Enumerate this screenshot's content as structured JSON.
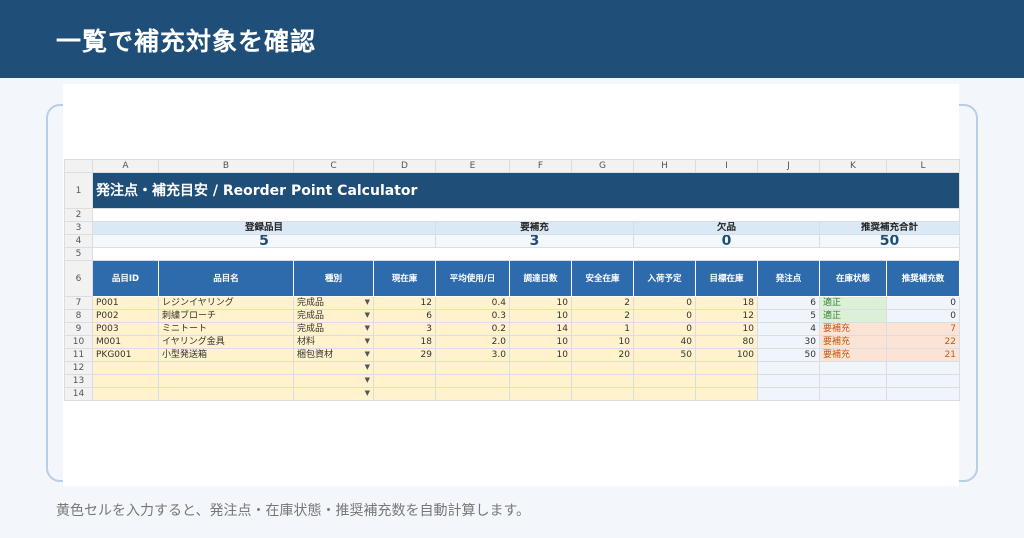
{
  "header": {
    "title": "一覧で補充対象を確認"
  },
  "footer": {
    "note": "黄色セルを入力すると、発注点・在庫状態・推奨補充数を自動計算します。"
  },
  "sheet": {
    "columns": [
      "A",
      "B",
      "C",
      "D",
      "E",
      "F",
      "G",
      "H",
      "I",
      "J",
      "K",
      "L"
    ],
    "rows": [
      "1",
      "2",
      "3",
      "4",
      "5",
      "6",
      "7",
      "8",
      "9",
      "10",
      "11",
      "12",
      "13",
      "14"
    ],
    "title": "発注点・補充目安 / Reorder Point Calculator",
    "kpis": [
      {
        "label": "登録品目",
        "value": "5"
      },
      {
        "label": "要補充",
        "value": "3"
      },
      {
        "label": "欠品",
        "value": "0"
      },
      {
        "label": "推奨補充合計",
        "value": "50"
      }
    ],
    "headers": [
      "品目ID",
      "品目名",
      "種別",
      "現在庫",
      "平均使用/日",
      "調達日数",
      "安全在庫",
      "入荷予定",
      "目標在庫",
      "発注点",
      "在庫状態",
      "推奨補充数"
    ],
    "dropdown_arrow": "▼",
    "items": [
      {
        "id": "P001",
        "name": "レジンイヤリング",
        "type": "完成品",
        "stock": "12",
        "avg": "0.4",
        "lead": "10",
        "safety": "2",
        "incoming": "0",
        "target": "18",
        "rop": "6",
        "status": "適正",
        "reorder": "0",
        "ok": true
      },
      {
        "id": "P002",
        "name": "刺繍ブローチ",
        "type": "完成品",
        "stock": "6",
        "avg": "0.3",
        "lead": "10",
        "safety": "2",
        "incoming": "0",
        "target": "12",
        "rop": "5",
        "status": "適正",
        "reorder": "0",
        "ok": true
      },
      {
        "id": "P003",
        "name": "ミニトート",
        "type": "完成品",
        "stock": "3",
        "avg": "0.2",
        "lead": "14",
        "safety": "1",
        "incoming": "0",
        "target": "10",
        "rop": "4",
        "status": "要補充",
        "reorder": "7",
        "ok": false
      },
      {
        "id": "M001",
        "name": "イヤリング金具",
        "type": "材料",
        "stock": "18",
        "avg": "2.0",
        "lead": "10",
        "safety": "10",
        "incoming": "40",
        "target": "80",
        "rop": "30",
        "status": "要補充",
        "reorder": "22",
        "ok": false
      },
      {
        "id": "PKG001",
        "name": "小型発送箱",
        "type": "梱包資材",
        "stock": "29",
        "avg": "3.0",
        "lead": "10",
        "safety": "20",
        "incoming": "50",
        "target": "100",
        "rop": "50",
        "status": "要補充",
        "reorder": "21",
        "ok": false
      }
    ]
  }
}
